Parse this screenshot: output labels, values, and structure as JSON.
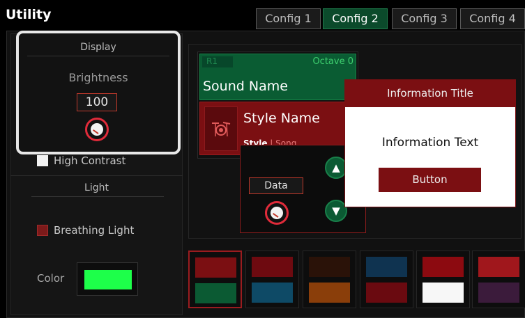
{
  "app": {
    "title": "Utility"
  },
  "tabs": [
    {
      "label": "Config 1",
      "active": false
    },
    {
      "label": "Config 2",
      "active": true
    },
    {
      "label": "Config 3",
      "active": false
    },
    {
      "label": "Config 4",
      "active": false
    }
  ],
  "display": {
    "title": "Display",
    "brightness_label": "Brightness",
    "brightness_value": "100",
    "high_contrast_label": "High Contrast"
  },
  "light": {
    "title": "Light",
    "breathing_label": "Breathing Light",
    "color_label": "Color",
    "color_value": "#1dff4a"
  },
  "part": {
    "badge": "R1",
    "octave": "Octave 0",
    "sound_name": "Sound Name",
    "style_name": "Style Name",
    "style_tab_a": "Style",
    "style_sep": " | ",
    "style_tab_b": "Song"
  },
  "data_popup": {
    "label": "Data",
    "up_icon": "triangle-up-icon",
    "down_icon": "triangle-down-icon"
  },
  "info_popup": {
    "title": "Information Title",
    "text": "Information Text",
    "button": "Button"
  },
  "presets": [
    {
      "top": "#7b0f12",
      "bottom": "#0b5a33"
    },
    {
      "top": "#6e0a10",
      "bottom": "#0e4a66"
    },
    {
      "top": "#2a1208",
      "bottom": "#8a3e0a"
    },
    {
      "top": "#0f3350",
      "bottom": "#6a0a10"
    },
    {
      "top": "#8c0a10",
      "bottom": "#f7f7f7"
    },
    {
      "top": "#a0171c",
      "bottom": "#3b1b3b"
    }
  ]
}
